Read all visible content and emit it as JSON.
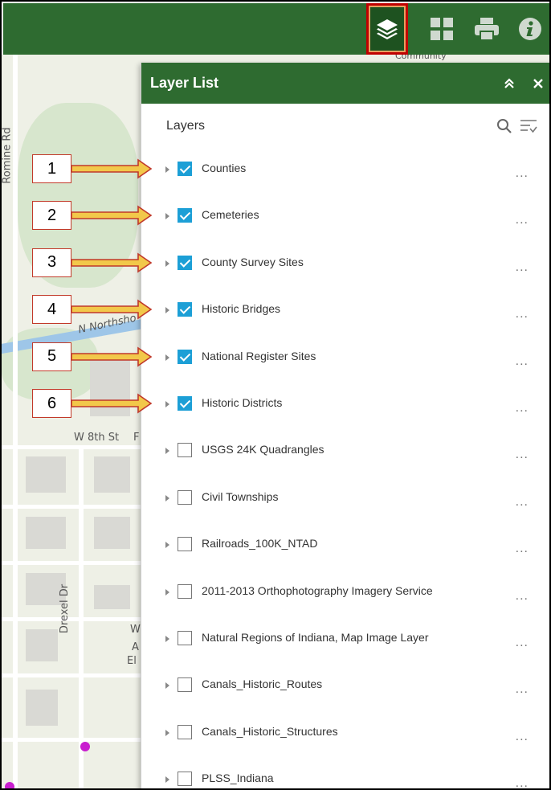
{
  "toolbar": {
    "tools": [
      {
        "icon": "layers-icon",
        "active": true
      },
      {
        "icon": "grid-icon",
        "active": false
      },
      {
        "icon": "print-icon",
        "active": false
      },
      {
        "icon": "info-icon",
        "active": false
      }
    ],
    "accent": "#2e6b30",
    "highlight": "#c00000"
  },
  "map": {
    "labels": {
      "romine_rd": "Romine Rd",
      "northshore": "N Northsho",
      "w8th": "W 8th St",
      "drexel": "Drexel Dr",
      "partial_w": "W",
      "partial_a": "A",
      "partial_el": "El",
      "partial_f": "F",
      "partial_community": "Community"
    },
    "dot_color": "#c81ecf"
  },
  "panel": {
    "title": "Layer List",
    "collapse_icon": "double-chevron-up-icon",
    "close_icon": "close-icon",
    "layers_label": "Layers",
    "check_color": "#1c9fd6",
    "layers": [
      {
        "name": "Counties",
        "checked": true
      },
      {
        "name": "Cemeteries",
        "checked": true
      },
      {
        "name": "County Survey Sites",
        "checked": true
      },
      {
        "name": "Historic Bridges",
        "checked": true
      },
      {
        "name": "National Register Sites",
        "checked": true
      },
      {
        "name": "Historic Districts",
        "checked": true
      },
      {
        "name": "USGS 24K Quadrangles",
        "checked": false
      },
      {
        "name": "Civil Townships",
        "checked": false
      },
      {
        "name": "Railroads_100K_NTAD",
        "checked": false
      },
      {
        "name": "2011-2013 Orthophotography Imagery Service",
        "checked": false
      },
      {
        "name": "Natural Regions of Indiana, Map Image Layer",
        "checked": false
      },
      {
        "name": "Canals_Historic_Routes",
        "checked": false
      },
      {
        "name": "Canals_Historic_Structures",
        "checked": false
      },
      {
        "name": "PLSS_Indiana",
        "checked": false
      }
    ],
    "more_label": "..."
  },
  "callouts": [
    "1",
    "2",
    "3",
    "4",
    "5",
    "6"
  ]
}
